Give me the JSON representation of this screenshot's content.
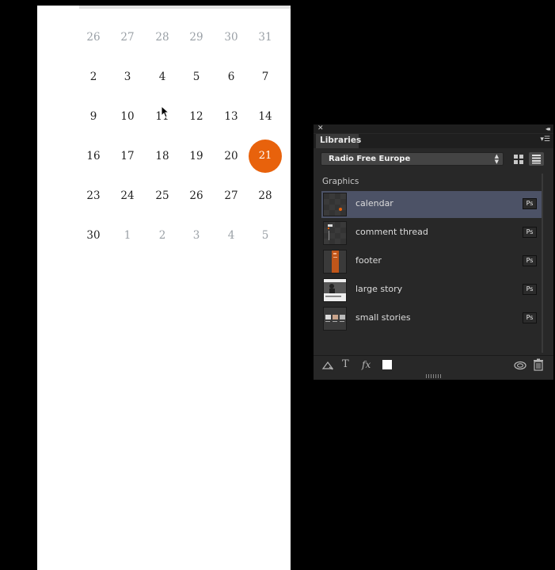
{
  "calendar": {
    "weeks": [
      [
        {
          "d": "26",
          "m": true
        },
        {
          "d": "27",
          "m": true
        },
        {
          "d": "28",
          "m": true
        },
        {
          "d": "29",
          "m": true
        },
        {
          "d": "30",
          "m": true
        },
        {
          "d": "31",
          "m": true
        }
      ],
      [
        {
          "d": "2"
        },
        {
          "d": "3"
        },
        {
          "d": "4"
        },
        {
          "d": "5"
        },
        {
          "d": "6"
        },
        {
          "d": "7"
        }
      ],
      [
        {
          "d": "9"
        },
        {
          "d": "10"
        },
        {
          "d": "11"
        },
        {
          "d": "12"
        },
        {
          "d": "13"
        },
        {
          "d": "14"
        }
      ],
      [
        {
          "d": "16"
        },
        {
          "d": "17"
        },
        {
          "d": "18"
        },
        {
          "d": "19"
        },
        {
          "d": "20"
        },
        {
          "d": "21",
          "sel": true
        }
      ],
      [
        {
          "d": "23"
        },
        {
          "d": "24"
        },
        {
          "d": "25"
        },
        {
          "d": "26"
        },
        {
          "d": "27"
        },
        {
          "d": "28"
        }
      ],
      [
        {
          "d": "30"
        },
        {
          "d": "1",
          "m": true
        },
        {
          "d": "2",
          "m": true
        },
        {
          "d": "3",
          "m": true
        },
        {
          "d": "4",
          "m": true
        },
        {
          "d": "5",
          "m": true
        }
      ]
    ],
    "accent_color": "#e8620c"
  },
  "panel": {
    "tab_label": "Libraries",
    "close_icon": "close-icon",
    "collapse_icon": "double-chevron-icon",
    "library_select": {
      "value": "Radio Free Europe"
    },
    "view_modes": [
      "grid-view-icon",
      "list-view-icon"
    ],
    "active_view": "list",
    "section_label": "Graphics",
    "items": [
      {
        "name": "calendar",
        "badge": "Ps",
        "selected": true,
        "thumb": "calendar"
      },
      {
        "name": "comment thread",
        "badge": "Ps",
        "thumb": "comment"
      },
      {
        "name": "footer",
        "badge": "Ps",
        "thumb": "footer"
      },
      {
        "name": "large story",
        "badge": "Ps",
        "thumb": "large"
      },
      {
        "name": "small stories",
        "badge": "Ps",
        "thumb": "small"
      }
    ],
    "footer_buttons": [
      "add-color-icon",
      "text-style-icon",
      "fx-layer-style-icon",
      "color-swatch-icon",
      "creative-cloud-sync-icon",
      "trash-icon"
    ],
    "selected_item_color": "#4c5266"
  }
}
